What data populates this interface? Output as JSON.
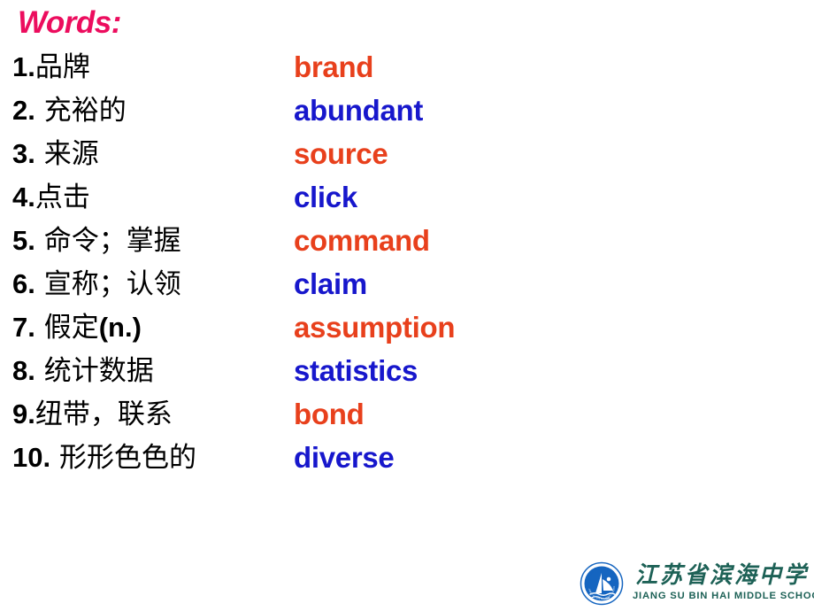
{
  "slide": {
    "title": "Words:",
    "title_color": "#ec0d5e",
    "background_color": "#ffffff",
    "accent_orange": "#e8401c",
    "accent_blue": "#1717cc"
  },
  "words": [
    {
      "index": "1.",
      "chinese": "品牌",
      "latin": "",
      "english": "brand",
      "color": "#e8401c"
    },
    {
      "index": "2.",
      "chinese": " 充裕的",
      "latin": "",
      "english": "abundant",
      "color": "#1717cc"
    },
    {
      "index": "3.",
      "chinese": " 来源",
      "latin": "",
      "english": "source",
      "color": "#e8401c"
    },
    {
      "index": "4.",
      "chinese": "点击",
      "latin": "",
      "english": "click",
      "color": "#1717cc"
    },
    {
      "index": "5.",
      "chinese": " 命令；掌握",
      "latin": "",
      "english": "command",
      "color": "#e8401c"
    },
    {
      "index": "6.",
      "chinese": " 宣称；认领",
      "latin": "",
      "english": "claim",
      "color": "#1717cc"
    },
    {
      "index": "7.",
      "chinese": " 假定",
      "latin": "(n.)",
      "english": "assumption",
      "color": "#e8401c"
    },
    {
      "index": "8.",
      "chinese": " 统计数据",
      "latin": "",
      "english": "statistics",
      "color": "#1717cc"
    },
    {
      "index": "9.",
      "chinese": "纽带，联系",
      "latin": "",
      "english": "bond",
      "color": "#e8401c"
    },
    {
      "index": "10.",
      "chinese": " 形形色色的",
      "latin": "",
      "english": "diverse",
      "color": "#1717cc"
    }
  ],
  "logo": {
    "chinese_name": "江苏省滨海中学",
    "english_name": "JIANG SU BIN HAI MIDDLE SCHOOL",
    "text_color": "#1d6156",
    "emblem_color": "#1565c0",
    "emblem_icon": "sailboat-emblem-icon"
  }
}
